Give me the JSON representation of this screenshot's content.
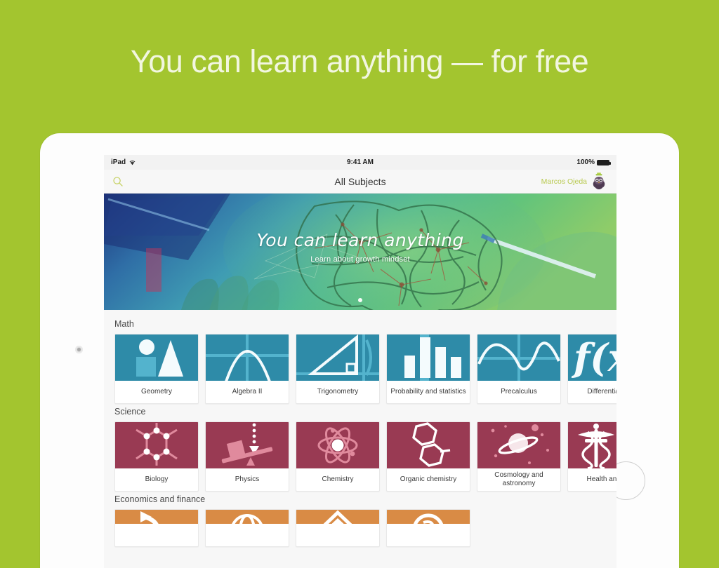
{
  "headline": "You can learn anything — for free",
  "background_color": "#a3c52f",
  "device": {
    "type": "ipad",
    "camera_name": "front-camera",
    "home_button_name": "home-button"
  },
  "statusbar": {
    "carrier": "iPad",
    "wifi_icon": "wifi-icon",
    "time": "9:41 AM",
    "battery_percent": "100%",
    "battery_icon": "battery-full-icon"
  },
  "navbar": {
    "search_icon": "search-icon",
    "title": "All Subjects",
    "user_name": "Marcos Ojeda",
    "avatar_icon": "owl-avatar"
  },
  "banner": {
    "title": "You can learn anything",
    "subtitle": "Learn about growth mindset",
    "page_dots": 1,
    "active_dot": 0
  },
  "sections": [
    {
      "label": "Math",
      "accent": "#2e8ba8",
      "cards": [
        {
          "label": "Geometry",
          "art": "shapes"
        },
        {
          "label": "Algebra II",
          "art": "parabola"
        },
        {
          "label": "Trigonometry",
          "art": "triangle"
        },
        {
          "label": "Probability and statistics",
          "art": "bars"
        },
        {
          "label": "Precalculus",
          "art": "sine"
        },
        {
          "label": "Differential cal",
          "art": "fx"
        }
      ]
    },
    {
      "label": "Science",
      "accent": "#993a53",
      "cards": [
        {
          "label": "Biology",
          "art": "molecule"
        },
        {
          "label": "Physics",
          "art": "lever"
        },
        {
          "label": "Chemistry",
          "art": "atom"
        },
        {
          "label": "Organic chemistry",
          "art": "hexagons"
        },
        {
          "label": "Cosmology and astronomy",
          "art": "planet"
        },
        {
          "label": "Health and me",
          "art": "caduceus"
        }
      ]
    },
    {
      "label": "Economics and finance",
      "accent": "#d98b45",
      "cards": [
        {
          "label": "",
          "art": "econ1"
        },
        {
          "label": "",
          "art": "econ2"
        },
        {
          "label": "",
          "art": "econ3"
        },
        {
          "label": "",
          "art": "econ4"
        }
      ]
    }
  ]
}
